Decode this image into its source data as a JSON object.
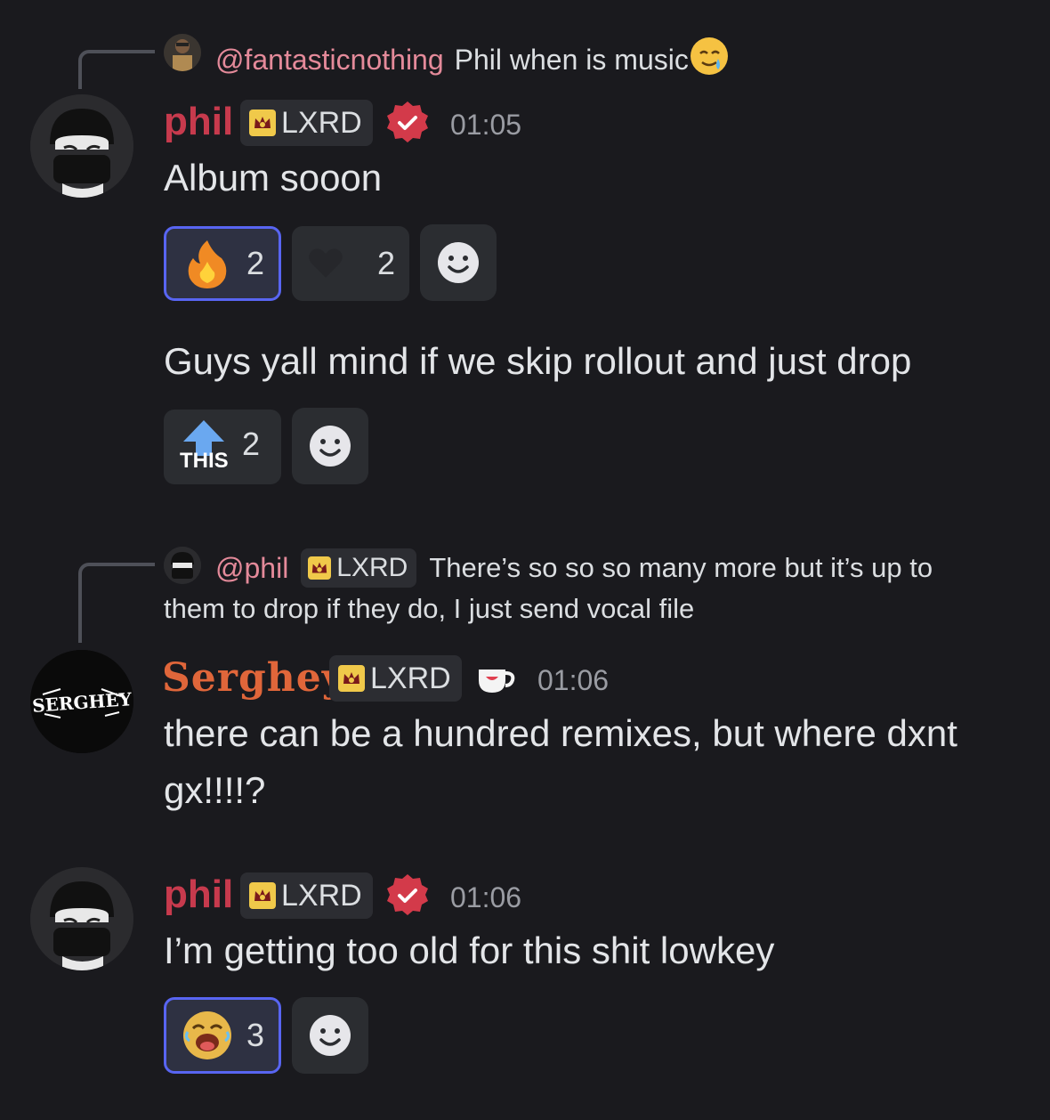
{
  "messages": [
    {
      "reply": {
        "mention": "@fantasticnothing",
        "text": "Phil when is music"
      },
      "username": "phil",
      "tag": "LXRD",
      "time": "01:05",
      "text": "Album sooon",
      "reactions": [
        {
          "emoji": "fire",
          "count": "2",
          "active": true
        },
        {
          "emoji": "black-heart",
          "count": "2",
          "active": false
        }
      ]
    },
    {
      "text": "Guys yall mind if we skip rollout and just drop",
      "reactions": [
        {
          "emoji": "this-upvote",
          "label": "THIS",
          "count": "2",
          "active": false
        }
      ]
    },
    {
      "reply": {
        "mention": "@phil",
        "tag": "LXRD",
        "text_line1": "There’s so so so many more but it’s up to",
        "text_line2": "them to drop if they do, I just send vocal file"
      },
      "username": "Serghey",
      "avatar_text": "SERGHEY",
      "tag": "LXRD",
      "time": "01:06",
      "text_line1": "there can be a hundred remixes, but where dxnt",
      "text_line2": "gx!!!!?"
    },
    {
      "username": "phil",
      "tag": "LXRD",
      "time": "01:06",
      "text": "I’m getting too old for this shit lowkey",
      "reactions": [
        {
          "emoji": "laughing-face",
          "count": "3",
          "active": true
        }
      ]
    }
  ],
  "colors": {
    "background": "#1a1a1e",
    "username_phil": "#c73a4d",
    "username_serghey": "#e0663a",
    "active_reaction_border": "#5865f2",
    "verified_badge": "#d33a4a"
  }
}
